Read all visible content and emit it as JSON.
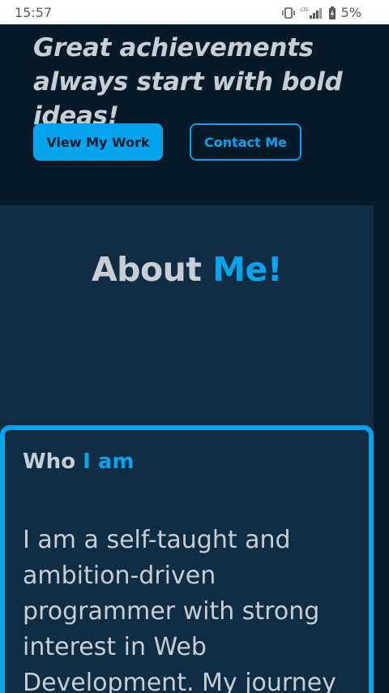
{
  "status_bar": {
    "time": "15:57",
    "network_label": "LTE",
    "battery_percent": "5%"
  },
  "hero": {
    "title": "Great achievements always start with bold ideas!",
    "primary_button": "View My Work",
    "secondary_button": "Contact Me"
  },
  "about": {
    "heading_plain": "About ",
    "heading_accent": "Me!",
    "card": {
      "title_plain": "Who ",
      "title_accent": "I am",
      "body": "I am a self-taught and ambition-driven programmer with strong interest in Web Development. My journey"
    }
  },
  "colors": {
    "accent": "#05a4ed",
    "hero_bg": "#061a29",
    "section_bg": "#102d44",
    "text": "#c8ced6"
  }
}
